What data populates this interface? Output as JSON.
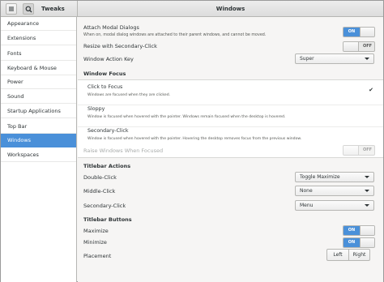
{
  "header": {
    "app_title": "Tweaks",
    "page_title": "Windows"
  },
  "sidebar": {
    "items": [
      {
        "label": "Appearance"
      },
      {
        "label": "Extensions"
      },
      {
        "label": "Fonts"
      },
      {
        "label": "Keyboard & Mouse"
      },
      {
        "label": "Power"
      },
      {
        "label": "Sound"
      },
      {
        "label": "Startup Applications"
      },
      {
        "label": "Top Bar"
      },
      {
        "label": "Windows",
        "active": true
      },
      {
        "label": "Workspaces"
      }
    ]
  },
  "main": {
    "attach_modal": {
      "label": "Attach Modal Dialogs",
      "description": "When on, modal dialog windows are attached to their parent windows, and cannot be moved.",
      "state": "ON"
    },
    "resize_secondary": {
      "label": "Resize with Secondary-Click",
      "state": "OFF"
    },
    "action_key": {
      "label": "Window Action Key",
      "value": "Super"
    },
    "window_focus": {
      "header": "Window Focus",
      "options": [
        {
          "title": "Click to Focus",
          "description": "Windows are focused when they are clicked.",
          "checked": true
        },
        {
          "title": "Sloppy",
          "description": "Window is focused when hovered with the pointer. Windows remain focused when the desktop is hovered."
        },
        {
          "title": "Secondary-Click",
          "description": "Window is focused when hovered with the pointer. Hovering the desktop removes focus from the previous window."
        }
      ],
      "check_glyph": "✔"
    },
    "raise_windows": {
      "label": "Raise Windows When Focused",
      "state": "OFF"
    },
    "titlebar_actions": {
      "header": "Titlebar Actions",
      "double_click": {
        "label": "Double-Click",
        "value": "Toggle Maximize"
      },
      "middle_click": {
        "label": "Middle-Click",
        "value": "None"
      },
      "secondary_click": {
        "label": "Secondary-Click",
        "value": "Menu"
      }
    },
    "titlebar_buttons": {
      "header": "Titlebar Buttons",
      "maximize": {
        "label": "Maximize",
        "state": "ON"
      },
      "minimize": {
        "label": "Minimize",
        "state": "ON"
      },
      "placement": {
        "label": "Placement",
        "left": "Left",
        "right": "Right"
      }
    }
  },
  "colors": {
    "accent": "#4a90d9",
    "background": "#f6f5f4"
  }
}
